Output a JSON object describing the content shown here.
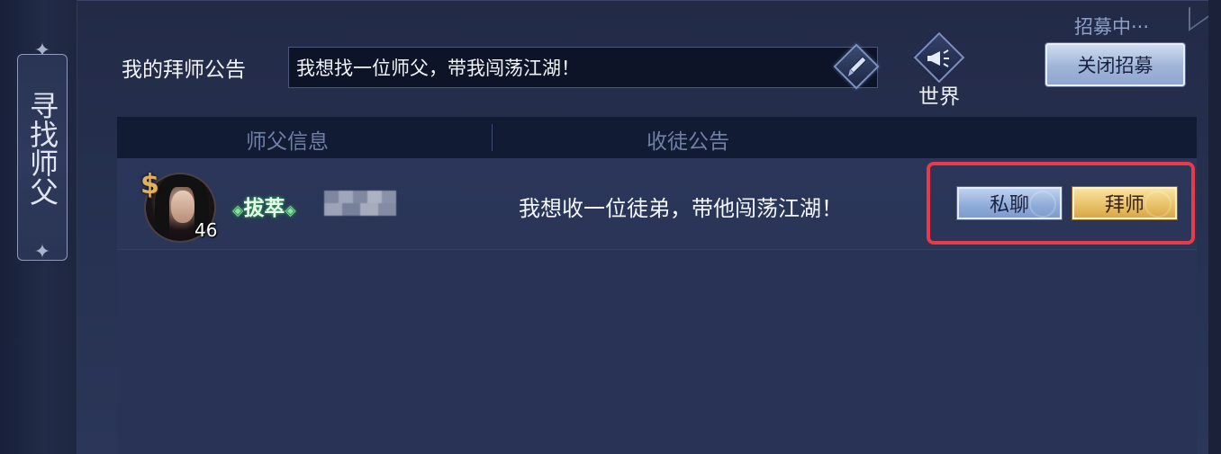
{
  "side_tab": {
    "label": "寻找师父"
  },
  "header": {
    "notice_label": "我的拜师公告",
    "notice_value": "我想找一位师父，带我闯荡江湖！",
    "world_label": "世界",
    "recruit_status": "招募中···",
    "close_recruit_label": "关闭招募"
  },
  "list": {
    "columns": [
      "师父信息",
      "收徒公告"
    ],
    "rows": [
      {
        "level": "46",
        "title": "拔萃",
        "notice": "我想收一位徒弟，带他闯荡江湖！",
        "chat_label": "私聊",
        "apprentice_label": "拜师"
      }
    ]
  },
  "colors": {
    "highlight": "#e83a48",
    "title_glow": "#2fae55",
    "gold_button": "#e7bf66",
    "blue_button": "#8eaad8"
  },
  "icons": [
    "brush-icon",
    "megaphone-icon",
    "master-badge-icon"
  ]
}
